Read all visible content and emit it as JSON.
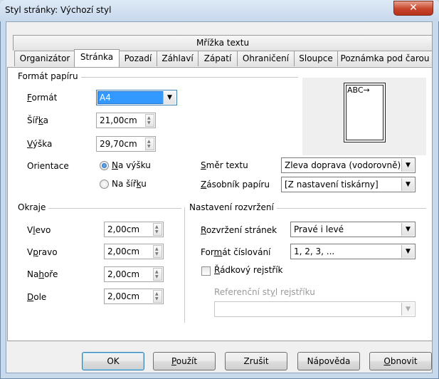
{
  "window": {
    "title": "Styl stránky: Výchozí styl",
    "close_glyph": "✕"
  },
  "tabs": {
    "top_row": [
      "Mřížka textu"
    ],
    "bottom_row": [
      "Organizátor",
      "Stránka",
      "Pozadí",
      "Záhlaví",
      "Zápatí",
      "Ohraničení",
      "Sloupce",
      "Poznámka pod čarou"
    ],
    "active": "Stránka"
  },
  "paper_format": {
    "heading": "Formát papíru",
    "format_label": "Formát",
    "format_value": "A4",
    "width_label": "Šířka",
    "width_value": "21,00cm",
    "height_label": "Výška",
    "height_value": "29,70cm",
    "orientation_label": "Orientace",
    "portrait_label": "Na výšku",
    "landscape_label": "Na šířku",
    "orientation_selected": "Na výšku"
  },
  "preview": {
    "text": "ABC→"
  },
  "text_direction": {
    "label": "Směr textu",
    "value": "Zleva doprava (vodorovně)"
  },
  "paper_tray": {
    "label": "Zásobník papíru",
    "value": "[Z nastavení tiskárny]"
  },
  "margins": {
    "heading": "Okraje",
    "left_label": "Vlevo",
    "left_value": "2,00cm",
    "right_label": "Vpravo",
    "right_value": "2,00cm",
    "top_label": "Nahoře",
    "top_value": "2,00cm",
    "bottom_label": "Dole",
    "bottom_value": "2,00cm"
  },
  "layout_settings": {
    "heading": "Nastavení rozvržení",
    "page_layout_label": "Rozvržení stránek",
    "page_layout_value": "Pravé i levé",
    "numbering_label": "Formát číslování",
    "numbering_value": "1, 2, 3, ...",
    "register_label": "Řádkový rejstřík",
    "register_checked": false,
    "ref_style_label": "Referenční styl rejstříku",
    "ref_style_value": ""
  },
  "buttons": {
    "ok": "OK",
    "apply": "Použít",
    "cancel": "Zrušit",
    "help": "Nápověda",
    "reset": "Obnovit"
  },
  "colors": {
    "selection": "#3399ff",
    "window_frame": "#c9d9ec",
    "close_button": "#c7452c"
  }
}
